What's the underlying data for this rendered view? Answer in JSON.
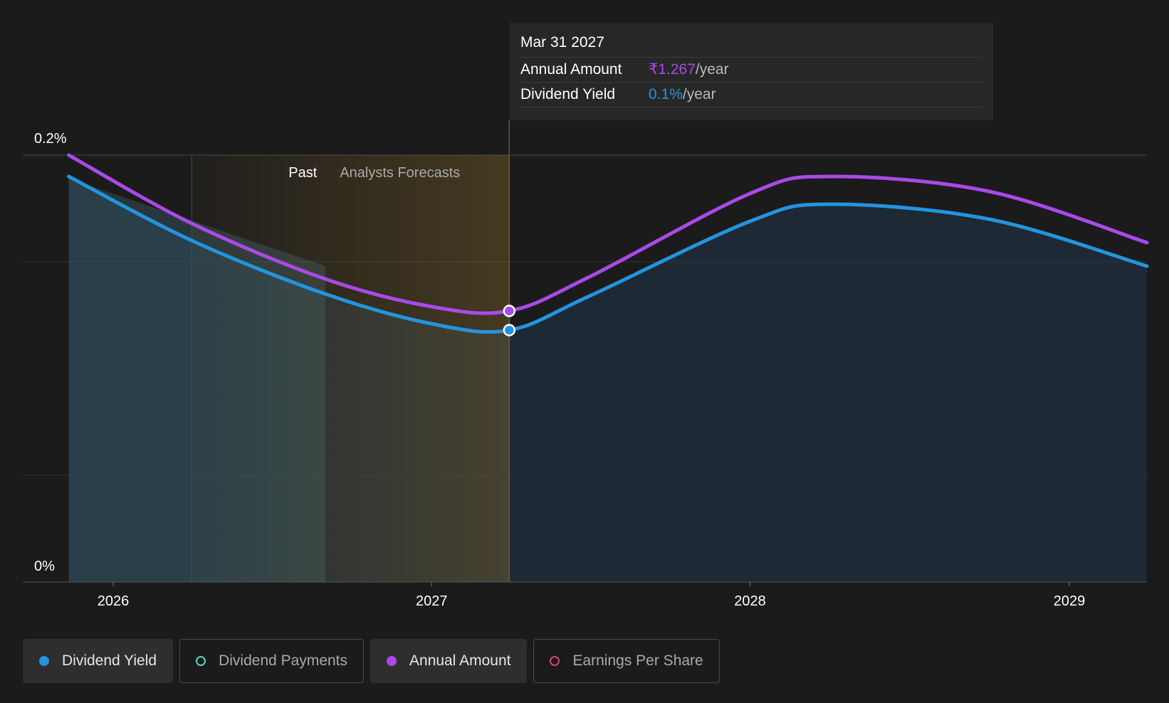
{
  "colors": {
    "background": "#1b1b1b",
    "dividend_yield": "#2394df",
    "annual_amount": "#a94ae8",
    "dividend_payments": "#5ed2c0",
    "earnings_per_share": "#d8447c",
    "past_region": "#8a6a2a"
  },
  "tooltip": {
    "date": "Mar 31 2027",
    "rows": [
      {
        "label": "Annual Amount",
        "value": "₹1.267",
        "unit": "/year",
        "color": "#a94ae8"
      },
      {
        "label": "Dividend Yield",
        "value": "0.1%",
        "unit": "/year",
        "color": "#2394df"
      }
    ]
  },
  "legend": [
    {
      "label": "Dividend Yield",
      "color": "#2394df",
      "active": true
    },
    {
      "label": "Dividend Payments",
      "color": "#5ed2c0",
      "active": false
    },
    {
      "label": "Annual Amount",
      "color": "#a94ae8",
      "active": true
    },
    {
      "label": "Earnings Per Share",
      "color": "#d8447c",
      "active": false
    }
  ],
  "chart_data": {
    "type": "line",
    "x_ticks": [
      "2026",
      "2027",
      "2028",
      "2029"
    ],
    "y_ticks": [
      "0.2%",
      "0%"
    ],
    "ylim": [
      0,
      0.2
    ],
    "regions": {
      "past_label": "Past",
      "forecast_label": "Analysts Forecasts",
      "divider_date": "2027-03-31"
    },
    "grid": true,
    "series": [
      {
        "name": "Dividend Yield",
        "color": "#2394df",
        "points": [
          {
            "x": "2025-11-11",
            "y": 0.19
          },
          {
            "x": "2026-04-01",
            "y": 0.16
          },
          {
            "x": "2026-09-01",
            "y": 0.135
          },
          {
            "x": "2027-01-01",
            "y": 0.121
          },
          {
            "x": "2027-03-31",
            "y": 0.118
          },
          {
            "x": "2027-07-01",
            "y": 0.134
          },
          {
            "x": "2028-01-01",
            "y": 0.169
          },
          {
            "x": "2028-04-01",
            "y": 0.177
          },
          {
            "x": "2028-10-01",
            "y": 0.17
          },
          {
            "x": "2029-03-31",
            "y": 0.148
          }
        ],
        "area": true
      },
      {
        "name": "Annual Amount",
        "color": "#a94ae8",
        "points": [
          {
            "x": "2025-11-11",
            "y": 0.2
          },
          {
            "x": "2026-04-01",
            "y": 0.168
          },
          {
            "x": "2026-09-01",
            "y": 0.142
          },
          {
            "x": "2027-01-01",
            "y": 0.129
          },
          {
            "x": "2027-03-31",
            "y": 0.127
          },
          {
            "x": "2027-07-01",
            "y": 0.143
          },
          {
            "x": "2028-01-01",
            "y": 0.182
          },
          {
            "x": "2028-04-01",
            "y": 0.19
          },
          {
            "x": "2028-10-01",
            "y": 0.183
          },
          {
            "x": "2029-03-31",
            "y": 0.159
          }
        ],
        "area": false
      }
    ],
    "history_area": [
      {
        "x": "2025-11-11",
        "y": 0.189
      },
      {
        "x": "2026-09-01",
        "y": 0.148
      }
    ]
  }
}
